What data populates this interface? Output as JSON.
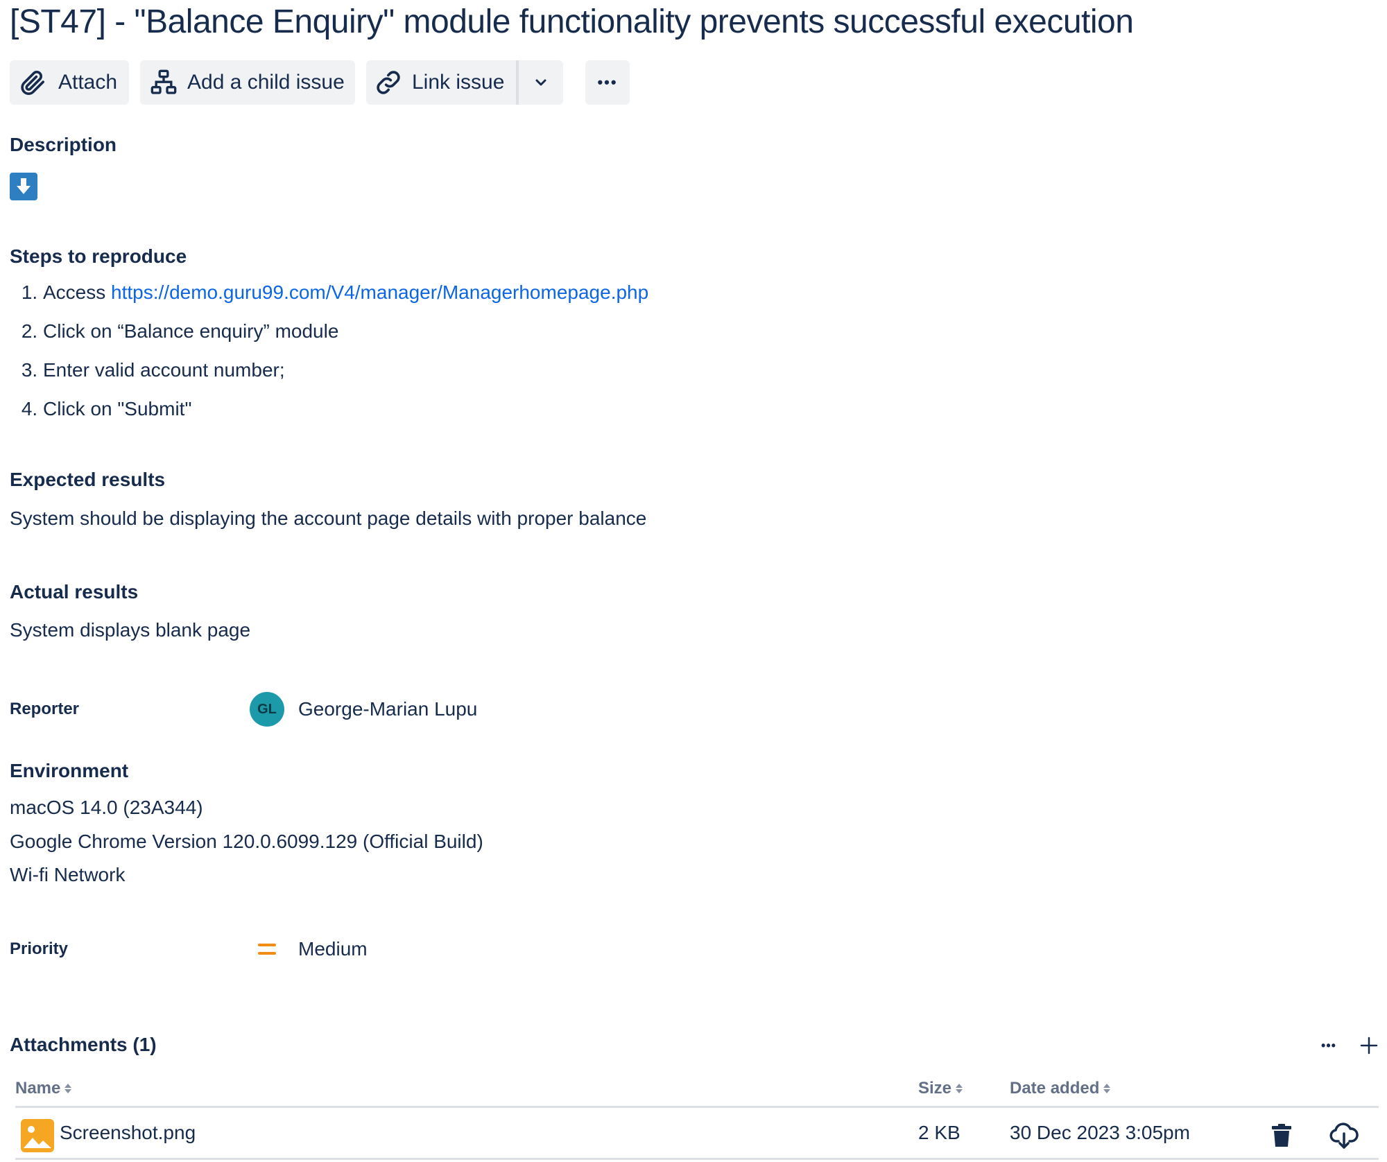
{
  "issue": {
    "title": "[ST47] - \"Balance Enquiry\" module functionality prevents successful execution"
  },
  "toolbar": {
    "attach_label": "Attach",
    "child_issue_label": "Add a child issue",
    "link_issue_label": "Link issue",
    "more_label": "•••"
  },
  "description": {
    "heading": "Description",
    "steps_heading": "Steps to reproduce",
    "steps": [
      {
        "prefix": "Access ",
        "link": "https://demo.guru99.com/V4/manager/Managerhomepage.php"
      },
      {
        "text": "Click on “Balance enquiry” module"
      },
      {
        "text": "Enter valid account number;"
      },
      {
        "text": "Click on \"Submit\""
      }
    ],
    "expected_heading": "Expected results",
    "expected_text": "System should be displaying the account page details with proper balance",
    "actual_heading": "Actual results",
    "actual_text": "System displays blank page"
  },
  "reporter": {
    "label": "Reporter",
    "initials": "GL",
    "name": "George-Marian Lupu",
    "avatar_color": "#1d9aaa"
  },
  "environment": {
    "heading": "Environment",
    "lines": [
      "macOS 14.0 (23A344)",
      "Google Chrome Version 120.0.6099.129 (Official Build)",
      "Wi-fi Network"
    ]
  },
  "priority": {
    "label": "Priority",
    "value": "Medium",
    "icon": "priority-medium-icon",
    "color": "#f18d13"
  },
  "attachments": {
    "heading": "Attachments (1)",
    "columns": {
      "name": "Name",
      "size": "Size",
      "date": "Date added"
    },
    "rows": [
      {
        "name": "Screenshot.png",
        "size": "2 KB",
        "date": "30 Dec 2023 3:05pm"
      }
    ]
  },
  "colors": {
    "text": "#172b4d",
    "link": "#0c66e4",
    "button_bg": "#f1f2f4",
    "image_icon": "#f5a623",
    "download_icon": "#2d7fc1"
  }
}
